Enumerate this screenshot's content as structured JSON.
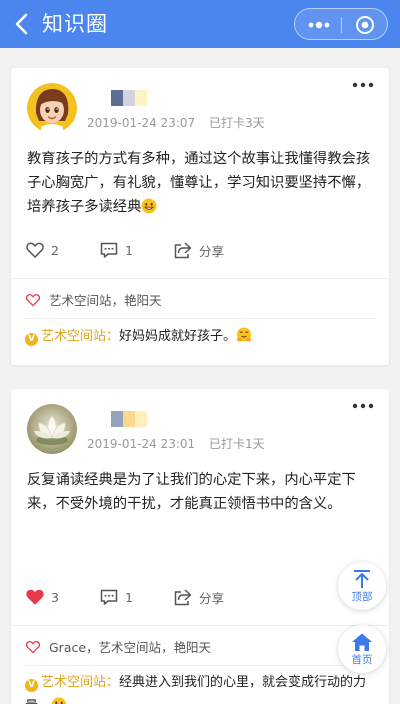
{
  "header": {
    "title": "知识圈",
    "bar_color": "#4a86ee"
  },
  "posts": [
    {
      "avatar": "cartoon-girl-avatar",
      "name_colors": [
        "#5d6e90",
        "#cfd4df",
        "#fff3c6"
      ],
      "date": "2019-01-24 23:07",
      "checkin": "已打卡3天",
      "text": "教育孩子的方式有多种，通过这个故事让我懂得教会孩子心胸宽广，有礼貌，懂尊让，学习知识要坚持不懈，培养孩子多读经典",
      "text_emoji": "smile",
      "likes": "2",
      "liked": false,
      "comments": "1",
      "share": "分享",
      "liked_by": "艺术空间站，艳阳天",
      "comment_author": "艺术空间站：",
      "comment_text": "好妈妈成就好孩子。",
      "comment_emoji": "hug"
    },
    {
      "avatar": "lotus-flower-avatar",
      "name_colors": [
        "#96a3bd",
        "#fad98d",
        "#fff0bd"
      ],
      "date": "2019-01-24 23:01",
      "checkin": "已打卡1天",
      "text": "反复诵读经典是为了让我们的心定下来，内心平定下来，不受外境的干扰，才能真正领悟书中的含义。",
      "text_emoji": "",
      "likes": "3",
      "liked": true,
      "comments": "1",
      "share": "分享",
      "liked_by": "Grace，艺术空间站，艳阳天",
      "comment_author": "艺术空间站：",
      "comment_text": "经典进入到我们的心里，就会变成行动的力量。",
      "comment_emoji": "grin"
    }
  ],
  "floating": {
    "top_label": "顶部",
    "home_label": "首页"
  },
  "colors": {
    "accent": "#3b7be8",
    "like_red": "#e8394d",
    "vip_gold": "#e0a31b"
  }
}
